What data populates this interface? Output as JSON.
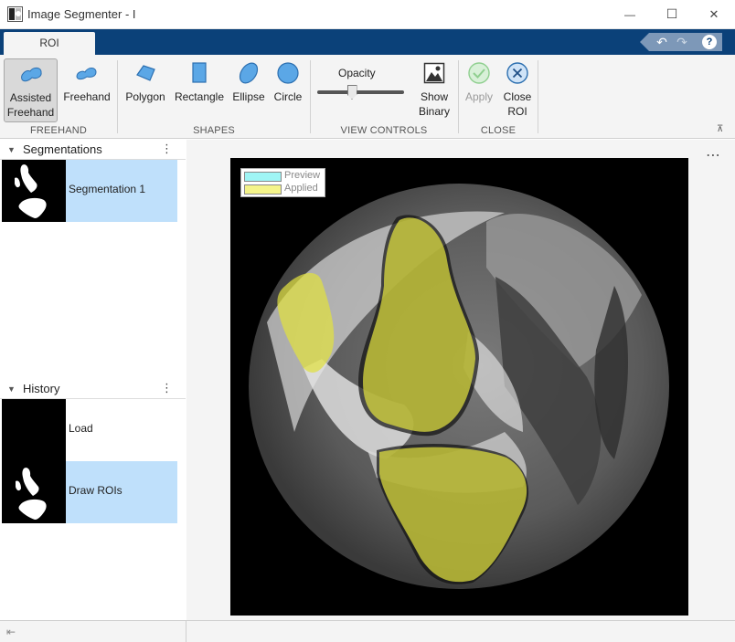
{
  "window": {
    "title": "Image Segmenter - I",
    "minimize_glyph": "—",
    "maximize_glyph": "☐",
    "close_glyph": "✕"
  },
  "tabs": [
    {
      "label": "ROI"
    }
  ],
  "quick_access": {
    "undo_glyph": "↶",
    "redo_glyph": "↷",
    "help_glyph": "?"
  },
  "ribbon": {
    "freehand": {
      "label": "FREEHAND",
      "assisted_line1": "Assisted",
      "assisted_line2": "Freehand",
      "freehand": "Freehand"
    },
    "shapes": {
      "label": "SHAPES",
      "polygon": "Polygon",
      "rectangle": "Rectangle",
      "ellipse": "Ellipse",
      "circle": "Circle"
    },
    "view_controls": {
      "label": "VIEW CONTROLS",
      "opacity": "Opacity",
      "opacity_value": 0.4,
      "show_binary_line1": "Show",
      "show_binary_line2": "Binary"
    },
    "close": {
      "label": "CLOSE",
      "apply": "Apply",
      "close_roi_line1": "Close",
      "close_roi_line2": "ROI"
    }
  },
  "segmentations": {
    "title": "Segmentations",
    "items": [
      {
        "label": "Segmentation 1"
      }
    ]
  },
  "history": {
    "title": "History",
    "items": [
      {
        "label": "Load"
      },
      {
        "label": "Draw ROIs"
      }
    ]
  },
  "canvas": {
    "menu_glyph": "⋯",
    "legend": {
      "preview": "Preview",
      "applied": "Applied"
    }
  },
  "colors": {
    "accent": "#0b4179",
    "selection": "#bfe0fb",
    "roi_blue": "#5ba7e6",
    "applied": "#f4f48a",
    "preview": "#9ff5f5",
    "overlay": "#e0e040"
  },
  "icons": {
    "assisted_freehand": "assisted-freehand-icon",
    "freehand": "freehand-icon",
    "polygon": "polygon-icon",
    "rectangle": "rectangle-icon",
    "ellipse": "ellipse-icon",
    "circle": "circle-icon",
    "show_binary": "show-binary-icon",
    "apply": "check-circle-icon",
    "close_roi": "x-circle-icon"
  }
}
